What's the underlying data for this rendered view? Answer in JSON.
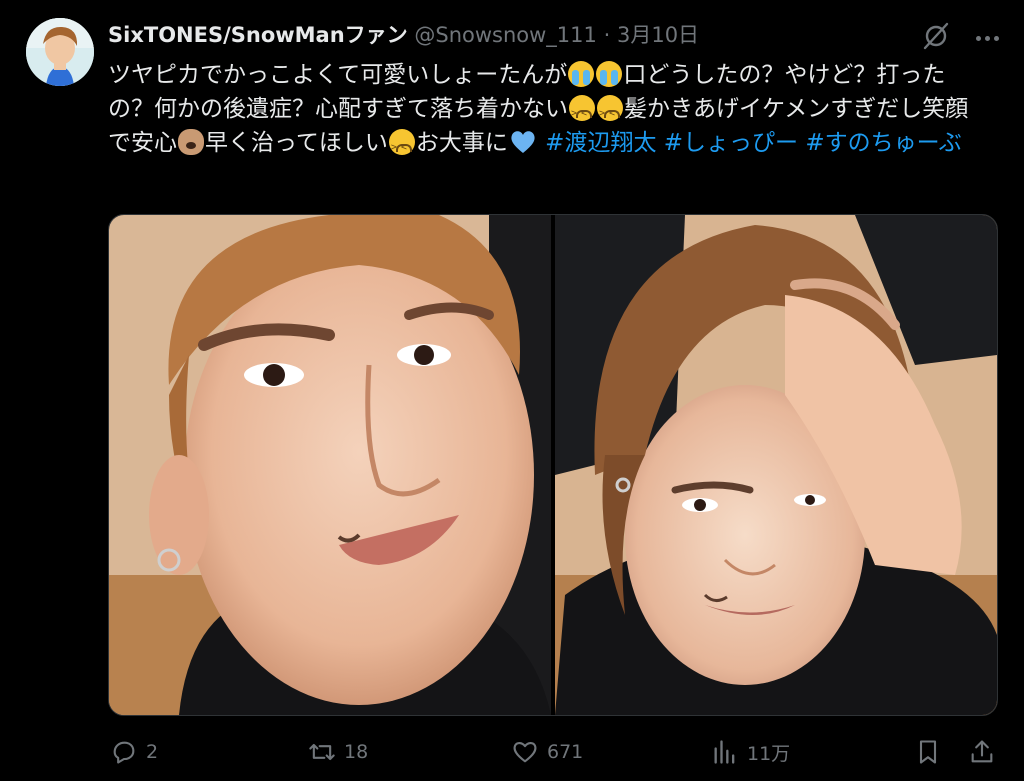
{
  "tweet": {
    "display_name": "SixTONES/SnowManファン",
    "handle": "@Snowsnow_111",
    "separator": "·",
    "date": "3月10日",
    "text_segments": [
      "ツヤピカでかっこよくて可愛いしょーたんが",
      "口どうしたの？やけど？打ったの？何かの後遺症？心配すぎて落ち着かない",
      "髪かきあげイケメンすぎだし笑顔で安心",
      "早く治ってほしい",
      "お大事に"
    ],
    "hashtags": [
      "#渡辺翔太",
      "#しょっぴー",
      "#すのちゅーぶ"
    ],
    "emoji": {
      "sob": "loudly-crying-face-emoji",
      "tired": "tired-face-emoji",
      "dog": "dog-face-emoji",
      "heart": "light-blue-heart-emoji"
    }
  },
  "actions": {
    "replies": "2",
    "retweets": "18",
    "likes": "671",
    "views": "11万"
  },
  "colors": {
    "background": "#000000",
    "text": "#e7e9ea",
    "muted": "#71767b",
    "link": "#1d9bf0",
    "heart_emoji": "#6cb4f2"
  },
  "media": {
    "count": 2,
    "photos": [
      "photo-close-up-face",
      "photo-hand-in-hair"
    ]
  }
}
